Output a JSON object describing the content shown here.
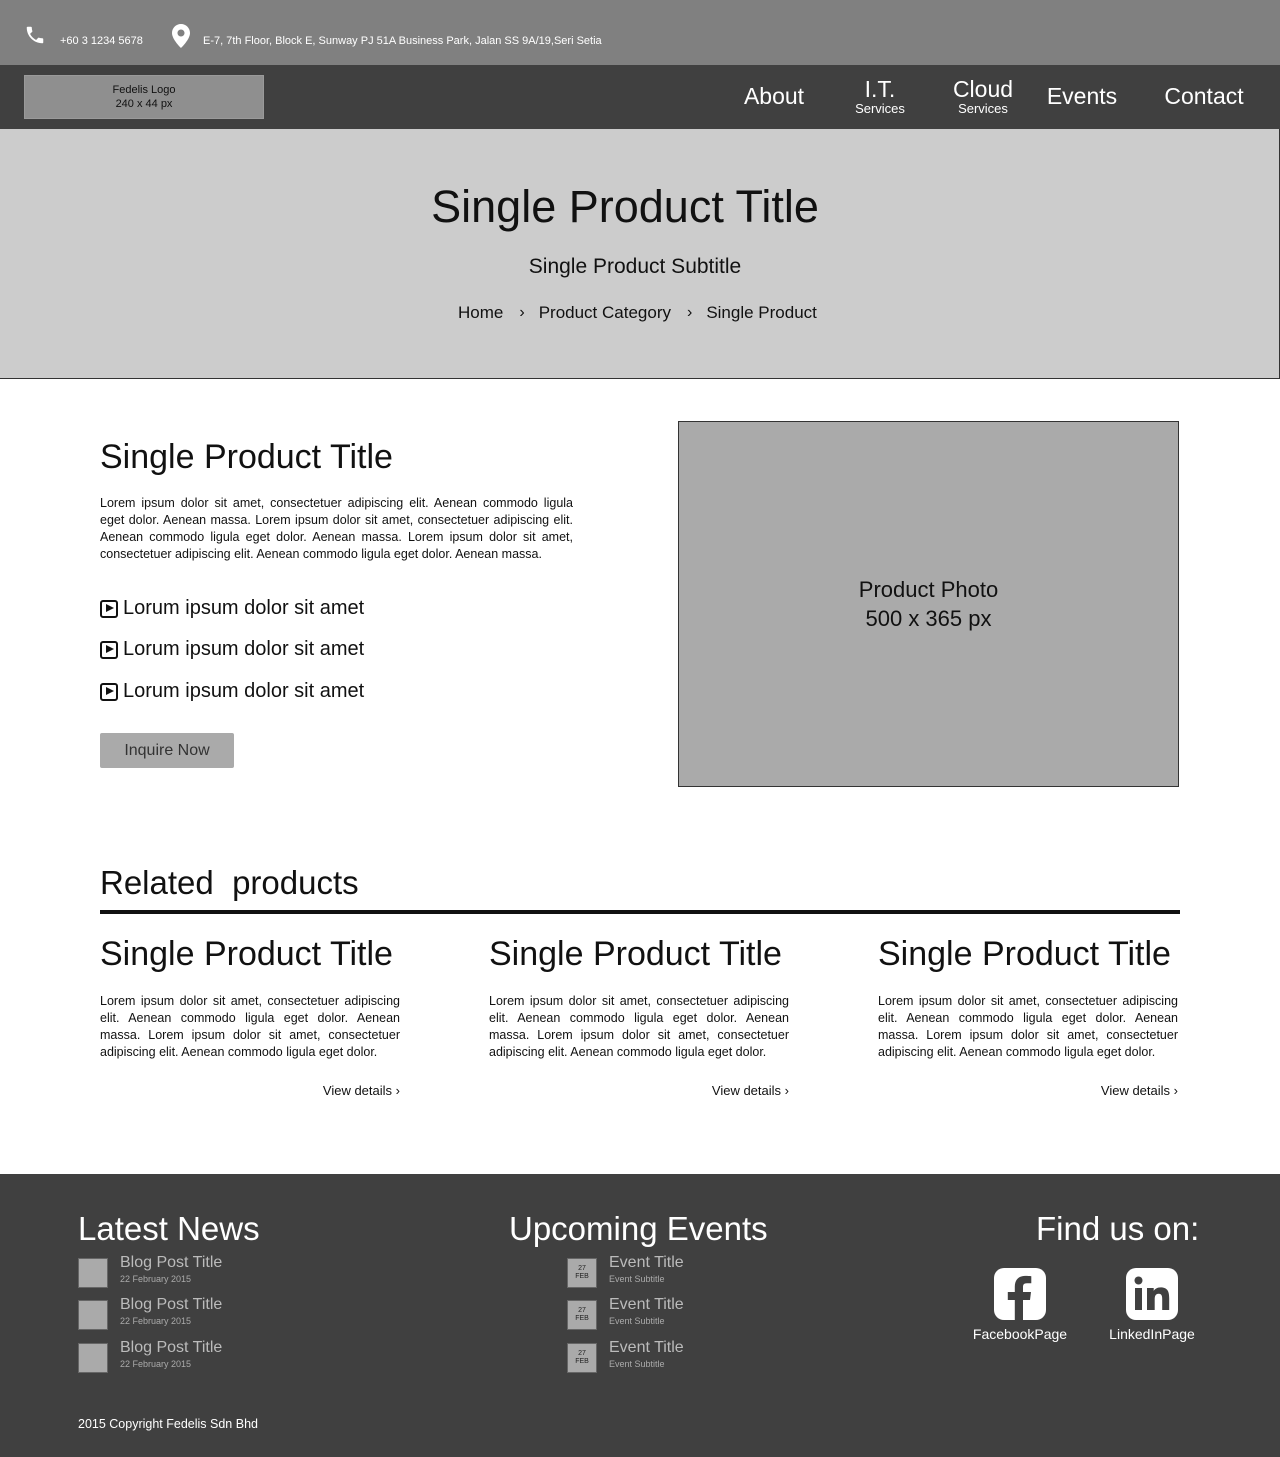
{
  "topbar": {
    "phone": "+60 3 1234 5678",
    "address": "E-7, 7th Floor, Block E, Sunway PJ 51A Business Park, Jalan SS 9A/19,Seri Setia"
  },
  "nav": {
    "logo_line1": "Fedelis Logo",
    "logo_line2": "240 x 44 px",
    "items": [
      {
        "label": "About",
        "sub": ""
      },
      {
        "label": "I.T.",
        "sub": "Services"
      },
      {
        "label": "Cloud",
        "sub": "Services"
      },
      {
        "label": "Events",
        "sub": ""
      },
      {
        "label": "Contact",
        "sub": ""
      }
    ]
  },
  "hero": {
    "title": "Single Product Title",
    "subtitle": "Single Product Subtitle",
    "breadcrumb": [
      "Home",
      "Product Category",
      "Single Product"
    ]
  },
  "product": {
    "title": "Single Product Title",
    "description": "Lorem ipsum dolor sit amet, consectetuer adipiscing elit. Aenean commodo ligula eget dolor. Aenean massa. Lorem ipsum dolor sit amet, consectetuer adipiscing elit. Aenean commodo ligula eget dolor. Aenean massa. Lorem ipsum dolor sit amet, consectetuer adipiscing elit. Aenean commodo ligula eget dolor. Aenean massa.",
    "features": [
      "Lorum ipsum dolor sit amet",
      "Lorum ipsum dolor sit amet",
      "Lorum ipsum dolor sit amet"
    ],
    "cta": "Inquire Now",
    "photo_line1": "Product Photo",
    "photo_line2": "500 x 365 px"
  },
  "related": {
    "heading": "Related  products",
    "cards": [
      {
        "title": "Single Product Title",
        "description": "Lorem ipsum dolor sit amet, consectetuer adipiscing elit. Aenean commodo ligula eget dolor. Aenean massa. Lorem ipsum dolor sit amet, consectetuer adipiscing elit. Aenean commodo ligula eget dolor.",
        "link": "View details"
      },
      {
        "title": "Single Product Title",
        "description": "Lorem ipsum dolor sit amet, consectetuer adipiscing elit. Aenean commodo ligula eget dolor. Aenean massa. Lorem ipsum dolor sit amet, consectetuer adipiscing elit. Aenean commodo ligula eget dolor.",
        "link": "View details"
      },
      {
        "title": "Single Product Title",
        "description": "Lorem ipsum dolor sit amet, consectetuer adipiscing elit. Aenean commodo ligula eget dolor. Aenean massa. Lorem ipsum dolor sit amet, consectetuer adipiscing elit. Aenean commodo ligula eget dolor.",
        "link": "View details"
      }
    ]
  },
  "footer": {
    "news_heading": "Latest News",
    "news": [
      {
        "title": "Blog Post Title",
        "date": "22 February 2015"
      },
      {
        "title": "Blog Post Title",
        "date": "22 February 2015"
      },
      {
        "title": "Blog Post Title",
        "date": "22 February 2015"
      }
    ],
    "events_heading": "Upcoming Events",
    "events": [
      {
        "day": "27",
        "month": "FEB",
        "title": "Event Title",
        "subtitle": "Event Subtitle"
      },
      {
        "day": "27",
        "month": "FEB",
        "title": "Event Title",
        "subtitle": "Event Subtitle"
      },
      {
        "day": "27",
        "month": "FEB",
        "title": "Event Title",
        "subtitle": "Event Subtitle"
      }
    ],
    "social_heading": "Find us on:",
    "social": [
      {
        "label": "FacebookPage",
        "icon": "facebook-icon"
      },
      {
        "label": "LinkedInPage",
        "icon": "linkedin-icon"
      }
    ],
    "copyright": "2015 Copyright Fedelis Sdn Bhd"
  },
  "colors": {
    "topbar": "#808080",
    "nav": "#404040",
    "hero": "#cccccc",
    "placeholder": "#aaaaaa",
    "footer": "#404040"
  }
}
